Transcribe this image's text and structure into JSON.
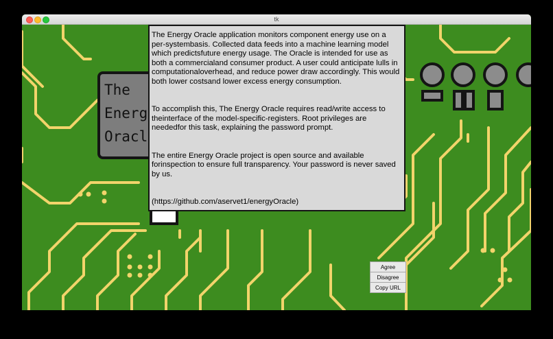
{
  "window": {
    "title": "tk"
  },
  "logo": {
    "lines": [
      "The",
      "Energy",
      "Oracle"
    ]
  },
  "dialog": {
    "paragraph1": "The Energy Oracle application monitors component energy use on a per-systembasis. Collected data feeds into a machine learning model which predictsfuture energy usage. The Oracle is intended for use as both a commercialand consumer product. A user could anticipate lulls in computationaloverhead, and reduce power draw accordingly. This would both lower costsand lower excess energy consumption.",
    "paragraph2": "To accomplish this, The Energy Oracle requires read/write access to theinterface of the model-specific-registers. Root privileges are neededfor this task, explaining the password prompt.",
    "paragraph3": "The entire Energy Oracle project is open source and available forinspection to ensure full transparency. Your password is never saved by us.",
    "url": "(https://github.com/aservet1/energyOracle)"
  },
  "buttons": {
    "agree": "Agree",
    "disagree": "Disagree",
    "copy_url": "Copy URL"
  },
  "colors": {
    "board": "#3d8c1f",
    "trace": "#f2d46b",
    "dialog_bg": "#d9d9d9",
    "logo_bg": "#7d7d7d"
  }
}
